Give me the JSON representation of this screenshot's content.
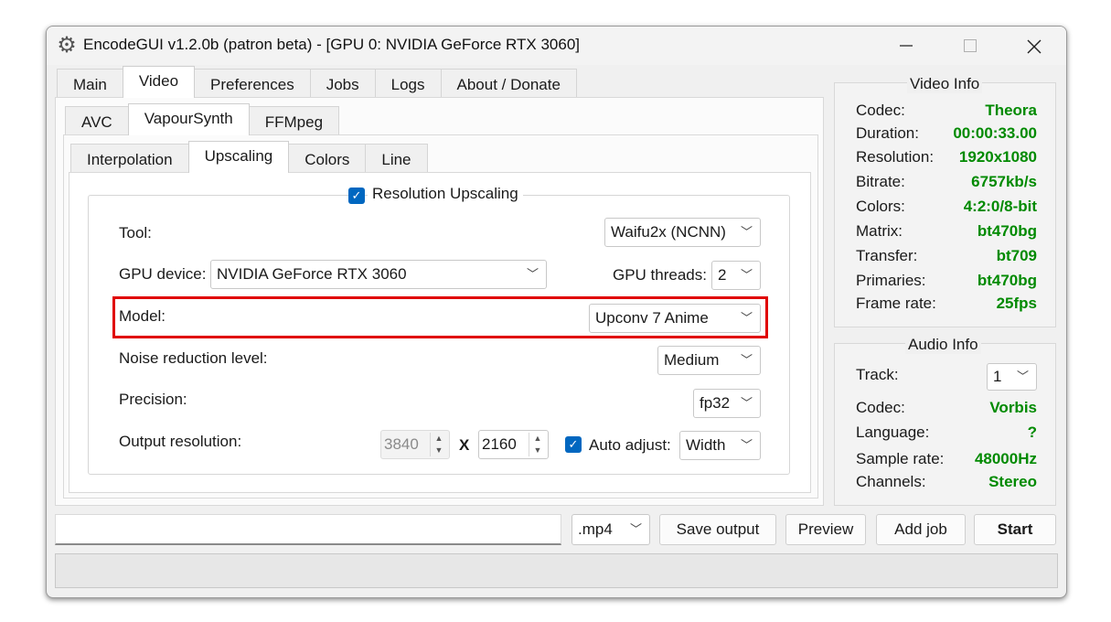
{
  "window": {
    "title": "EncodeGUI v1.2.0b (patron beta) - [GPU 0: NVIDIA GeForce RTX 3060]"
  },
  "main_tabs": [
    {
      "label": "Main"
    },
    {
      "label": "Video"
    },
    {
      "label": "Preferences"
    },
    {
      "label": "Jobs"
    },
    {
      "label": "Logs"
    },
    {
      "label": "About / Donate"
    }
  ],
  "codec_tabs": [
    {
      "label": "AVC"
    },
    {
      "label": "VapourSynth"
    },
    {
      "label": "FFMpeg"
    }
  ],
  "vs_tabs": [
    {
      "label": "Interpolation"
    },
    {
      "label": "Upscaling"
    },
    {
      "label": "Colors"
    },
    {
      "label": "Line"
    }
  ],
  "upscaling": {
    "group_label": "Resolution Upscaling",
    "tool_label": "Tool:",
    "tool_value": "Waifu2x (NCNN)",
    "gpu_device_label": "GPU device:",
    "gpu_device_value": "NVIDIA GeForce RTX 3060",
    "gpu_threads_label": "GPU threads:",
    "gpu_threads_value": "2",
    "model_label": "Model:",
    "model_value": "Upconv 7 Anime",
    "noise_label": "Noise reduction level:",
    "noise_value": "Medium",
    "precision_label": "Precision:",
    "precision_value": "fp32",
    "output_label": "Output resolution:",
    "width_value": "3840",
    "x_sep": "X",
    "height_value": "2160",
    "auto_adjust_label": "Auto adjust:",
    "auto_adjust_value": "Width"
  },
  "video_info": {
    "title": "Video Info",
    "rows": [
      {
        "k": "Codec:",
        "v": "Theora"
      },
      {
        "k": "Duration:",
        "v": "00:00:33.00"
      },
      {
        "k": "Resolution:",
        "v": "1920x1080"
      },
      {
        "k": "Bitrate:",
        "v": "6757kb/s"
      },
      {
        "k": "Colors:",
        "v": "4:2:0/8-bit"
      },
      {
        "k": "Matrix:",
        "v": "bt470bg"
      },
      {
        "k": "Transfer:",
        "v": "bt709"
      },
      {
        "k": "Primaries:",
        "v": "bt470bg"
      },
      {
        "k": "Frame rate:",
        "v": "25fps"
      }
    ]
  },
  "audio_info": {
    "title": "Audio Info",
    "track_label": "Track:",
    "track_value": "1",
    "rows": [
      {
        "k": "Codec:",
        "v": "Vorbis"
      },
      {
        "k": "Language:",
        "v": "?"
      },
      {
        "k": "Sample rate:",
        "v": "48000Hz"
      },
      {
        "k": "Channels:",
        "v": "Stereo"
      }
    ]
  },
  "bottom": {
    "output_path": "",
    "container": ".mp4",
    "save_output": "Save output",
    "preview": "Preview",
    "add_job": "Add job",
    "start": "Start"
  },
  "colors": {
    "accent": "#0067c0",
    "info_value": "#008a00",
    "highlight": "#e00000"
  }
}
